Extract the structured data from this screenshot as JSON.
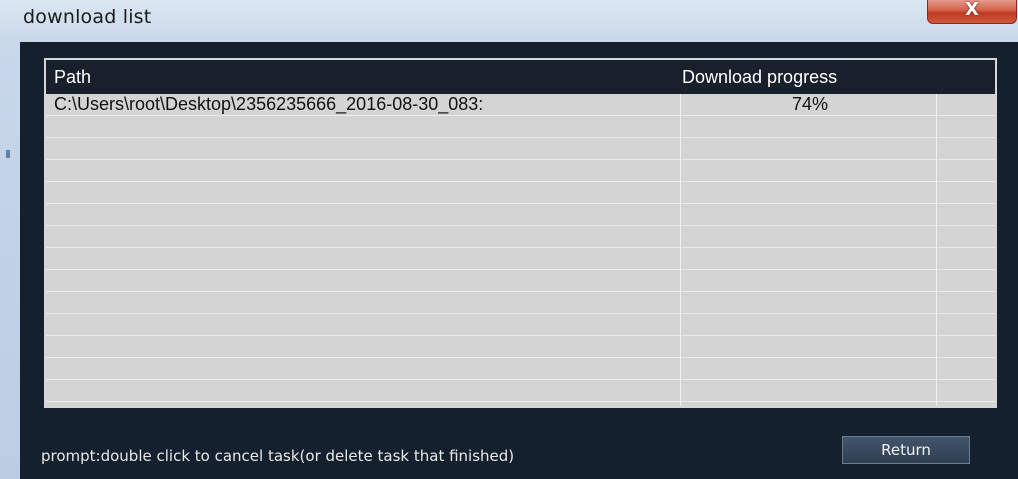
{
  "window": {
    "title": "download list",
    "close_label": "X"
  },
  "list": {
    "columns": {
      "path": "Path",
      "progress": "Download progress"
    },
    "rows": [
      {
        "path": "C:\\Users\\root\\Desktop\\2356235666_2016-08-30_083:",
        "progress": "74%"
      },
      {
        "path": "",
        "progress": ""
      },
      {
        "path": "",
        "progress": ""
      },
      {
        "path": "",
        "progress": ""
      },
      {
        "path": "",
        "progress": ""
      },
      {
        "path": "",
        "progress": ""
      },
      {
        "path": "",
        "progress": ""
      },
      {
        "path": "",
        "progress": ""
      },
      {
        "path": "",
        "progress": ""
      },
      {
        "path": "",
        "progress": ""
      },
      {
        "path": "",
        "progress": ""
      },
      {
        "path": "",
        "progress": ""
      },
      {
        "path": "",
        "progress": ""
      },
      {
        "path": "",
        "progress": ""
      }
    ]
  },
  "footer": {
    "prompt": "prompt:double click to  cancel task(or delete task that finished)",
    "return_label": "Return"
  },
  "colors": {
    "titlebar": "#d2dfed",
    "client_background": "#15202e",
    "list_background": "#d4d4d4",
    "header_background": "#17202b",
    "close_button": "#c13b22"
  },
  "icons": {
    "close": "close-icon"
  }
}
